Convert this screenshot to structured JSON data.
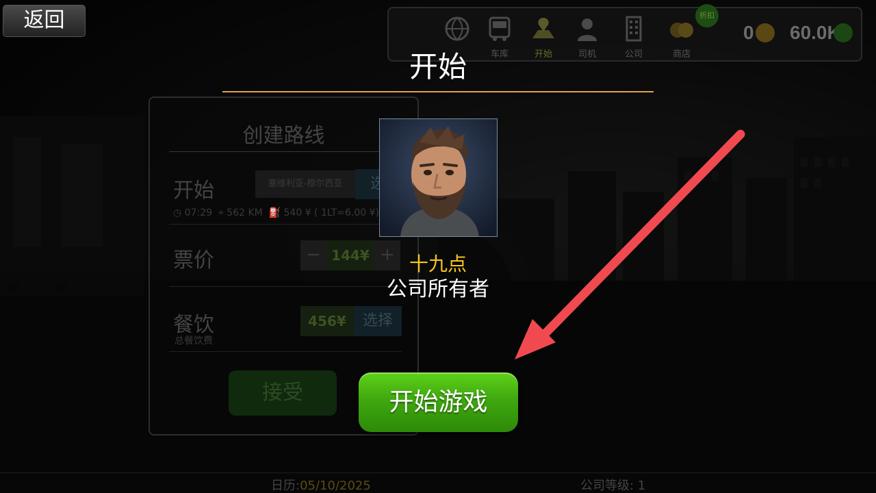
{
  "back_button": {
    "label": "返回"
  },
  "top_nav": {
    "items": [
      {
        "label": "",
        "icon": "globe-icon"
      },
      {
        "label": "车库",
        "icon": "bus-icon"
      },
      {
        "label": "开始",
        "icon": "map-pin-icon",
        "active": true
      },
      {
        "label": "司机",
        "icon": "driver-icon"
      },
      {
        "label": "公司",
        "icon": "building-icon"
      },
      {
        "label": "商店",
        "icon": "coins-icon"
      }
    ],
    "sale_badge": "折扣",
    "gold_count": "0",
    "cash_count": "60.0K"
  },
  "route_panel": {
    "title": "创建路线",
    "start_label": "开始",
    "start_city": "塞维利亚-穆尔西亚",
    "select_label": "选",
    "time": "07:29",
    "distance": "562 KM",
    "fuel": "540 ¥ ( 1LT=6.00 ¥)",
    "ticket_label": "票价",
    "minus": "−",
    "ticket_price": "144¥",
    "plus": "+",
    "catering_label": "餐饮",
    "catering_sub": "总餐饮费",
    "catering_price": "456¥",
    "catering_select": "选择",
    "accept_label": "接受"
  },
  "status_bar": {
    "calendar_label": "日历:",
    "calendar_date": "05/10/2025",
    "company_level": "公司等级: 1"
  },
  "dialog": {
    "title": "开始",
    "player_name": "十九点",
    "player_role": "公司所有者",
    "start_button": "开始游戏"
  },
  "colors": {
    "accent_line": "#e9a04e",
    "name_yellow": "#f7c520",
    "start_green": "#3fa80f",
    "arrow_red": "#f04a50"
  }
}
